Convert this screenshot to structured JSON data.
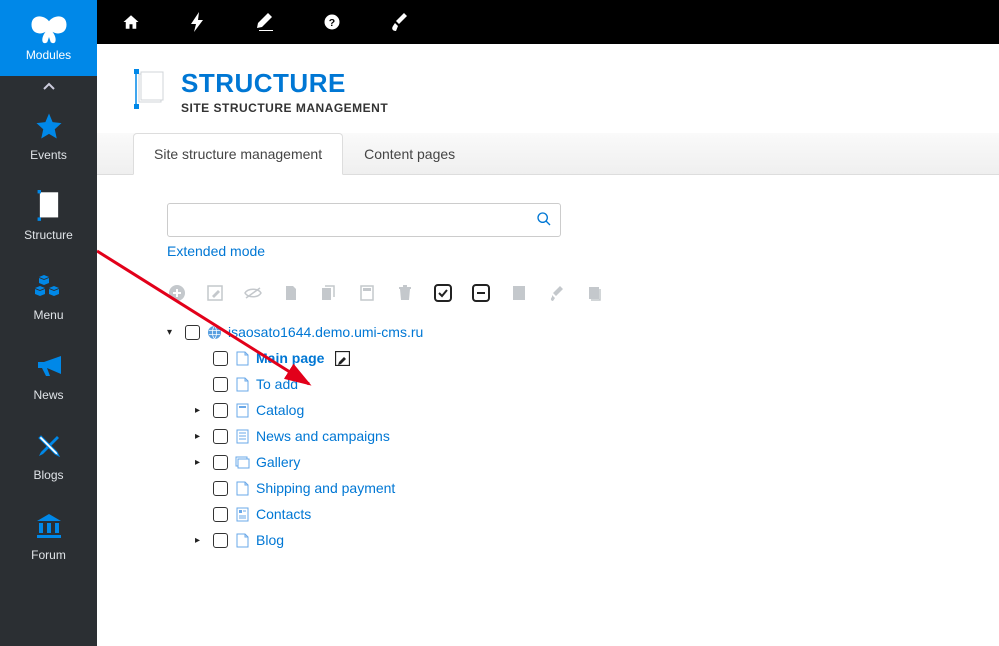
{
  "sidebar": {
    "header_label": "Modules",
    "items": [
      {
        "label": "Events"
      },
      {
        "label": "Structure"
      },
      {
        "label": "Menu"
      },
      {
        "label": "News"
      },
      {
        "label": "Blogs"
      },
      {
        "label": "Forum"
      }
    ]
  },
  "page": {
    "title": "STRUCTURE",
    "subtitle": "SITE STRUCTURE MANAGEMENT"
  },
  "tabs": [
    {
      "label": "Site structure management",
      "active": true
    },
    {
      "label": "Content pages",
      "active": false
    }
  ],
  "search": {
    "placeholder": "",
    "extended_label": "Extended mode"
  },
  "tree": {
    "root": "isaosato1644.demo.umi-cms.ru",
    "children": [
      {
        "label": "Main page",
        "bold": true,
        "expandable": false,
        "has_edit": true
      },
      {
        "label": "To add",
        "expandable": false
      },
      {
        "label": "Catalog",
        "expandable": true
      },
      {
        "label": "News and campaigns",
        "expandable": true
      },
      {
        "label": "Gallery",
        "expandable": true
      },
      {
        "label": "Shipping and payment",
        "expandable": false
      },
      {
        "label": "Contacts",
        "expandable": false
      },
      {
        "label": "Blog",
        "expandable": true
      }
    ]
  }
}
